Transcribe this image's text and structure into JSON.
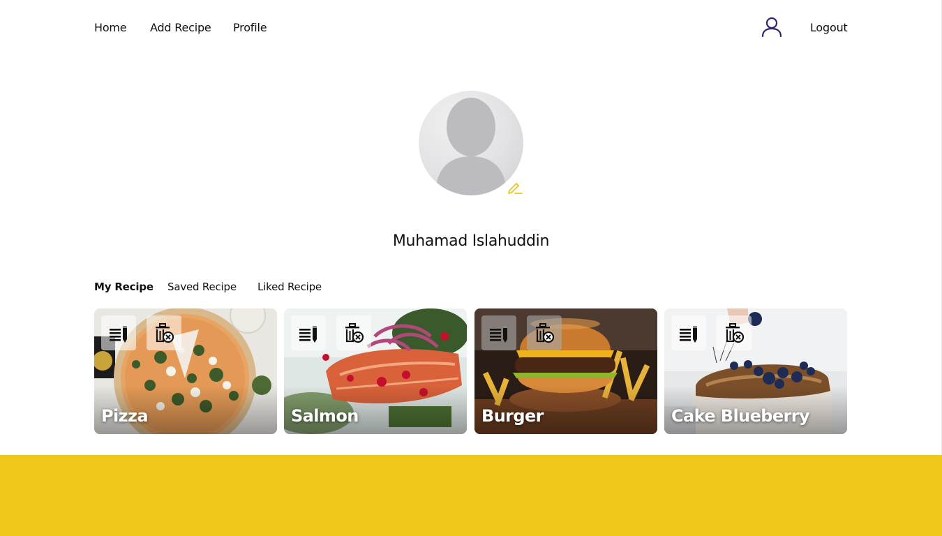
{
  "nav": {
    "home": "Home",
    "add_recipe": "Add Recipe",
    "profile": "Profile",
    "logout": "Logout",
    "user_icon": "user-icon"
  },
  "profile": {
    "name": "Muhamad Islahuddin",
    "avatar_icon": "default-avatar",
    "edit_icon": "pencil-icon"
  },
  "tabs": {
    "my_recipe": "My Recipe",
    "saved_recipe": "Saved Recipe",
    "liked_recipe": "Liked Recipe",
    "active": "My Recipe"
  },
  "recipes": [
    {
      "title": "Pizza"
    },
    {
      "title": "Salmon"
    },
    {
      "title": "Burger"
    },
    {
      "title": "Cake Blueberry"
    }
  ],
  "card_actions": {
    "edit_icon": "edit-list-icon",
    "delete_icon": "delete-icon"
  },
  "colors": {
    "accent_yellow": "#EFC81A",
    "edit_pencil": "#EFC81A",
    "user_icon": "#2E266F"
  }
}
